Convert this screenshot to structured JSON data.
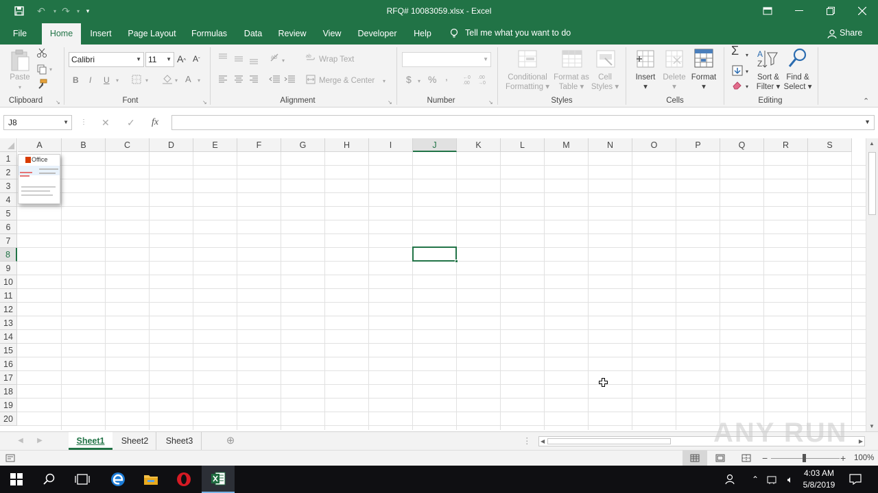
{
  "titlebar": {
    "title": "RFQ# 10083059.xlsx  -  Excel"
  },
  "tabs": [
    "File",
    "Home",
    "Insert",
    "Page Layout",
    "Formulas",
    "Data",
    "Review",
    "View",
    "Developer",
    "Help"
  ],
  "tell_me": "Tell me what you want to do",
  "share": "Share",
  "ribbon": {
    "clipboard": {
      "paste": "Paste",
      "label": "Clipboard"
    },
    "font": {
      "name": "Calibri",
      "size": "11",
      "label": "Font",
      "bold": "B",
      "italic": "I",
      "underline": "U"
    },
    "alignment": {
      "wrap_text": "Wrap Text",
      "merge_center": "Merge & Center",
      "label": "Alignment"
    },
    "number": {
      "format": "",
      "currency": "$",
      "percent": "%",
      "comma": ",",
      "label": "Number"
    },
    "styles": {
      "conditional": "Conditional",
      "conditional2": "Formatting",
      "format_as": "Format as",
      "format_as2": "Table",
      "cell": "Cell",
      "cell2": "Styles",
      "label": "Styles"
    },
    "cells": {
      "insert": "Insert",
      "delete": "Delete",
      "format": "Format",
      "label": "Cells"
    },
    "editing": {
      "sort": "Sort &",
      "sort2": "Filter",
      "find": "Find &",
      "find2": "Select",
      "label": "Editing"
    }
  },
  "formula_bar": {
    "name_box": "J8",
    "fx": "fx",
    "cancel": "✕",
    "enter": "✓",
    "value": ""
  },
  "columns": [
    "A",
    "B",
    "C",
    "D",
    "E",
    "F",
    "G",
    "H",
    "I",
    "J",
    "K",
    "L",
    "M",
    "N",
    "O",
    "P",
    "Q",
    "R",
    "S"
  ],
  "rows": [
    "1",
    "2",
    "3",
    "4",
    "5",
    "6",
    "7",
    "8",
    "9",
    "10",
    "11",
    "12",
    "13",
    "14",
    "15",
    "16",
    "17",
    "18",
    "19",
    "20"
  ],
  "selected_cell": {
    "col": "J",
    "row": "8"
  },
  "embedded_image": {
    "brand": "Office"
  },
  "sheets": [
    "Sheet1",
    "Sheet2",
    "Sheet3"
  ],
  "active_sheet": "Sheet1",
  "status": {
    "zoom": "100%"
  },
  "taskbar": {
    "time": "4:03 AM",
    "date": "5/8/2019"
  },
  "watermark": "ANY RUN",
  "colors": {
    "accent": "#217346",
    "ribbon_bg": "#f3f3f3",
    "taskbar": "#0f0f12"
  }
}
